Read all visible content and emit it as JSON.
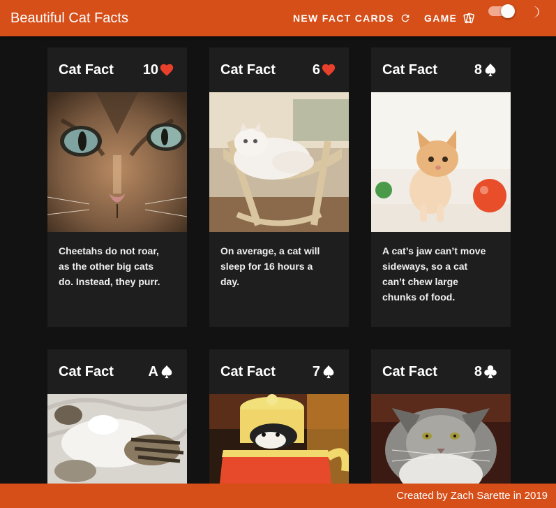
{
  "app": {
    "title": "Beautiful Cat Facts",
    "accent_color": "#d64e18",
    "background_color": "#121212",
    "card_color": "#1e1e1e"
  },
  "nav": {
    "new_fact_cards": {
      "label": "NEW FACT CARDS",
      "icon": "refresh-icon"
    },
    "game": {
      "label": "GAME",
      "icon": "playing-cards-icon"
    },
    "dark_mode_toggle": {
      "checked": true,
      "icon": "moon-icon"
    }
  },
  "cards": [
    {
      "title": "Cat Fact",
      "rank": "10",
      "suit": "heart",
      "suit_color": "#e8402a",
      "photo": "close-up tabby kitten face with blue-green eyes",
      "text": "Cheetahs do not roar, as the other big cats do. Instead, they purr."
    },
    {
      "title": "Cat Fact",
      "rank": "6",
      "suit": "heart",
      "suit_color": "#e8402a",
      "photo": "white fluffy cat sleeping in a hammock bed",
      "text": "On average, a cat will sleep for 16 hours a day."
    },
    {
      "title": "Cat Fact",
      "rank": "8",
      "suit": "spade",
      "suit_color": "#ffffff",
      "photo": "orange and white kitten with red ball",
      "text": "A cat’s jaw can’t move sideways, so a cat can’t chew large chunks of food."
    },
    {
      "title": "Cat Fact",
      "rank": "A",
      "suit": "spade",
      "suit_color": "#ffffff",
      "photo": "tabby and white cat lying on its back",
      "text": ""
    },
    {
      "title": "Cat Fact",
      "rank": "7",
      "suit": "spade",
      "suit_color": "#ffffff",
      "photo": "kitten peeking out of a yellow teapot",
      "text": ""
    },
    {
      "title": "Cat Fact",
      "rank": "8",
      "suit": "club",
      "suit_color": "#ffffff",
      "photo": "gray long-haired maine coon cat",
      "text": ""
    }
  ],
  "footer": {
    "text": "Created by Zach Sarette in 2019"
  }
}
